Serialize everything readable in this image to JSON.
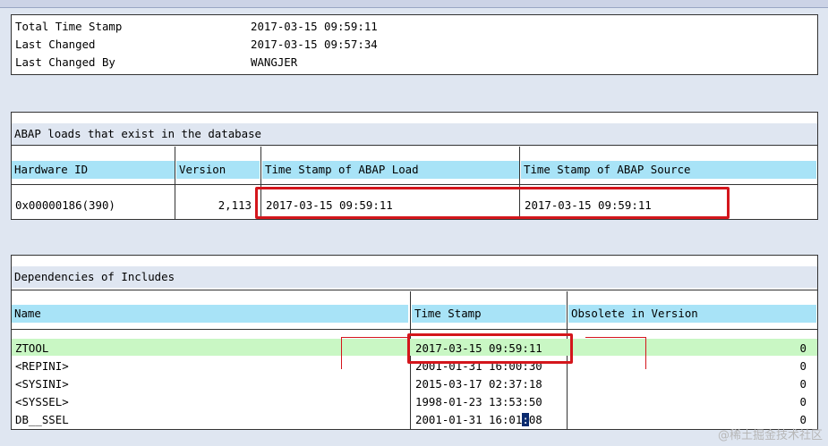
{
  "summary": {
    "rows": [
      {
        "label": "Total Time Stamp",
        "value": "2017-03-15 09:59:11"
      },
      {
        "label": "Last Changed",
        "value": "2017-03-15 09:57:34"
      },
      {
        "label": "Last Changed By",
        "value": "WANGJER"
      }
    ]
  },
  "loads": {
    "caption": "ABAP loads that exist in the database",
    "headers": {
      "hardware_id": "Hardware ID",
      "version": "Version",
      "ts_load": "Time Stamp of ABAP Load",
      "ts_source": "Time Stamp of ABAP Source"
    },
    "row": {
      "hardware_id": "0x00000186(390)",
      "version": "2,113",
      "ts_load": "2017-03-15 09:59:11",
      "ts_source": "2017-03-15 09:59:11"
    }
  },
  "deps": {
    "caption": "Dependencies of Includes",
    "headers": {
      "name": "Name",
      "time_stamp": "Time Stamp",
      "obsolete": "Obsolete in Version"
    },
    "rows": [
      {
        "name": "ZTOOL",
        "ts": "2017-03-15 09:59:11",
        "obsolete": "0"
      },
      {
        "name": "<REPINI>",
        "ts": "2001-01-31 16:00:30",
        "obsolete": "0"
      },
      {
        "name": "<SYSINI>",
        "ts": "2015-03-17 02:37:18",
        "obsolete": "0"
      },
      {
        "name": "<SYSSEL>",
        "ts": "1998-01-23 13:53:50",
        "obsolete": "0"
      },
      {
        "name": "DB__SSEL",
        "ts_a": "2001-01-31 16:01",
        "ts_sel": ":",
        "ts_b": "08",
        "obsolete": "0"
      }
    ]
  },
  "colors": {
    "highlight_row": "#c9f7c4",
    "header_bg": "#a8e3f7",
    "annotation_red": "#d4161c"
  },
  "watermark": "@稀土掘金技术社区"
}
